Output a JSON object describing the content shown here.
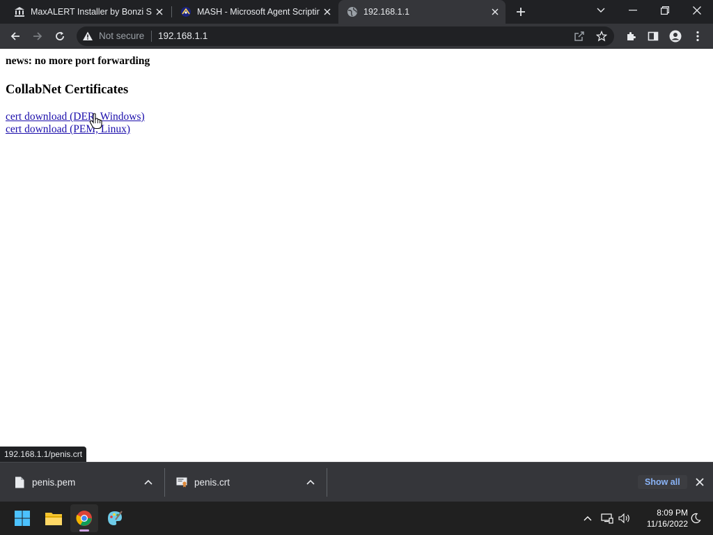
{
  "browser": {
    "tabs": [
      {
        "title": "MaxALERT Installer by Bonzi Software",
        "favicon": "bank-icon",
        "active": false
      },
      {
        "title": "MASH - Microsoft Agent Scripting Helper",
        "favicon": "mash-icon",
        "active": false
      },
      {
        "title": "192.168.1.1",
        "favicon": "globe-icon",
        "active": true
      }
    ],
    "address_bar": {
      "security_label": "Not secure",
      "url": "192.168.1.1"
    },
    "status_url": "192.168.1.1/penis.crt"
  },
  "page": {
    "news": "news: no more port forwarding",
    "heading": "CollabNet Certificates",
    "links": [
      {
        "label": "cert download (DER, Windows)"
      },
      {
        "label": "cert download (PEM, Linux)"
      }
    ]
  },
  "downloads": {
    "items": [
      {
        "filename": "penis.pem",
        "icon": "file-icon"
      },
      {
        "filename": "penis.crt",
        "icon": "certificate-icon"
      }
    ],
    "show_all_label": "Show all"
  },
  "taskbar": {
    "apps": [
      "windows-start",
      "file-explorer",
      "chrome",
      "paint"
    ],
    "time": "8:09 PM",
    "date": "11/16/2022"
  },
  "colors": {
    "link": "#1a0dab",
    "tabstrip": "#202124",
    "toolbar": "#35363a",
    "accent_blue": "#8ab4f8"
  }
}
